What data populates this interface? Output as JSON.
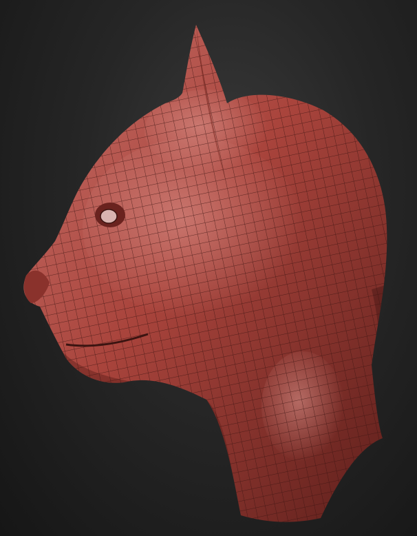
{
  "image": {
    "subject": "sculpted-cat-head-wireframe",
    "colors": {
      "background_inner": "#3a3a3a",
      "background_outer": "#161616",
      "clay_light": "#c8726b",
      "clay_mid": "#a9443c",
      "clay_dark": "#5e1f1b",
      "wire": "#3b1411"
    }
  }
}
